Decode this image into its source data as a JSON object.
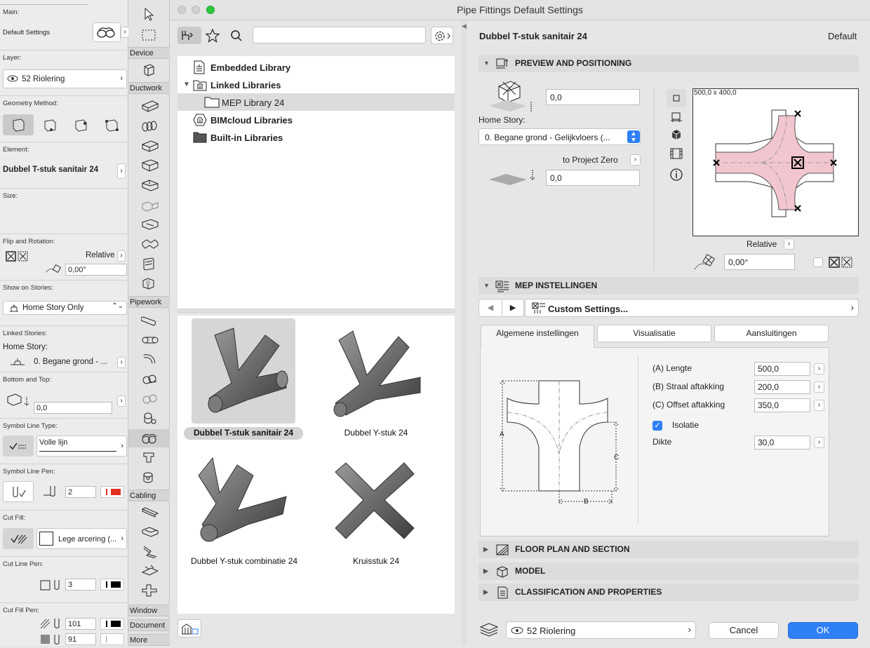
{
  "left_panel": {
    "main_label": "Main:",
    "default_settings": "Default Settings",
    "layer_label": "Layer:",
    "layer_value": "52 Riolering",
    "geometry_label": "Geometry Method:",
    "element_label": "Element:",
    "element_value": "Dubbel T-stuk sanitair 24",
    "size_label": "Size:",
    "flip_label": "Flip and Rotation:",
    "relative": "Relative",
    "rotation_value": "0,00°",
    "show_stories_label": "Show on Stories:",
    "show_stories_value": "Home Story Only",
    "linked_stories_label": "Linked Stories:",
    "home_story_label": "Home Story:",
    "home_story_value": "0. Begane grond - ...",
    "bottom_top_label": "Bottom and Top:",
    "bottom_value": "0,0",
    "symbol_line_type_label": "Symbol Line Type:",
    "symbol_line_type_value": "Volle lijn",
    "symbol_line_pen_label": "Symbol Line Pen:",
    "symbol_line_pen_value": "2",
    "cut_fill_label": "Cut Fill:",
    "cut_fill_value": "Lege arcering (...",
    "cut_line_pen_label": "Cut Line Pen:",
    "cut_line_pen_value": "3",
    "cut_fill_pen_label": "Cut Fill Pen:",
    "cut_fill_pen_1": "101",
    "cut_fill_pen_2": "91"
  },
  "toolbox": {
    "groups": [
      "Device",
      "Ductwork",
      "Pipework",
      "Cabling",
      "Window",
      "Document",
      "More"
    ]
  },
  "dialog": {
    "title": "Pipe Fittings Default Settings",
    "search_placeholder": "",
    "libraries": [
      {
        "label": "Embedded Library"
      },
      {
        "label": "Linked Libraries"
      },
      {
        "label": "MEP Library 24"
      },
      {
        "label": "BIMcloud Libraries"
      },
      {
        "label": "Built-in Libraries"
      }
    ],
    "thumbnails": [
      {
        "label": "Dubbel T-stuk sanitair 24"
      },
      {
        "label": "Dubbel Y-stuk 24"
      },
      {
        "label": "Dubbel Y-stuk combinatie 24"
      },
      {
        "label": "Kruisstuk 24"
      }
    ],
    "header_name": "Dubbel T-stuk sanitair 24",
    "header_default": "Default",
    "preview_section": "PREVIEW AND POSITIONING",
    "offset_top_value": "0,0",
    "home_story_label": "Home Story:",
    "home_story_value": "0. Begane grond - Gelijkvloers (...",
    "to_project_zero": "to Project Zero",
    "offset_bottom_value": "0,0",
    "preview_dims": "500,0 x 400,0",
    "relative": "Relative",
    "angle_value": "0,00°",
    "mep_section": "MEP INSTELLINGEN",
    "custom_settings": "Custom Settings...",
    "tabs": [
      "Algemene instellingen",
      "Visualisatie",
      "Aansluitingen"
    ],
    "params": [
      {
        "label": "(A) Lengte",
        "value": "500,0"
      },
      {
        "label": "(B) Straal aftakking",
        "value": "200,0"
      },
      {
        "label": "(C) Offset aftakking",
        "value": "350,0"
      }
    ],
    "isolatie": "Isolatie",
    "isolatie_checked": true,
    "dikte_label": "Dikte",
    "dikte_value": "30,0",
    "dim_a": "A",
    "dim_b": "B",
    "dim_c": "C",
    "floor_plan_section": "FLOOR PLAN AND SECTION",
    "model_section": "MODEL",
    "classification_section": "CLASSIFICATION AND PROPERTIES",
    "footer_layer": "52 Riolering",
    "cancel": "Cancel",
    "ok": "OK"
  },
  "colors": {
    "accent": "#2f7ff6",
    "pink_fill": "#f2c6cf"
  }
}
